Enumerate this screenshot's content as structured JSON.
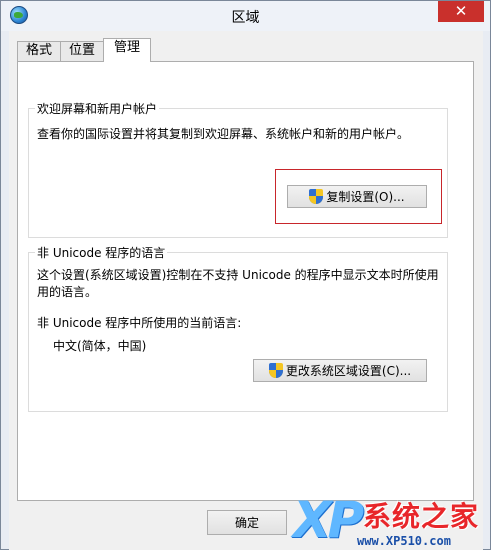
{
  "window": {
    "title": "区域",
    "close_glyph": "✕"
  },
  "tabs": [
    {
      "label": "格式",
      "active": false
    },
    {
      "label": "位置",
      "active": false
    },
    {
      "label": "管理",
      "active": true
    }
  ],
  "welcome_group": {
    "label": "欢迎屏幕和新用户帐户",
    "description": "查看你的国际设置并将其复制到欢迎屏幕、系统帐户和新的用户帐户。",
    "copy_button": "复制设置(O)...",
    "highlight_color": "#c8262b"
  },
  "non_unicode_group": {
    "label": "非 Unicode 程序的语言",
    "description_line1": "这个设置(系统区域设置)控制在不支持 Unicode 的程序中显示文本时所使用",
    "description_line2": "用的语言。",
    "current_label": "非 Unicode 程序中所使用的当前语言:",
    "current_value": "中文(简体，中国)",
    "change_button": "更改系统区域设置(C)..."
  },
  "footer": {
    "ok_button": "确定"
  },
  "watermark": {
    "brand": "XP",
    "name": "系统之家",
    "url": "www.XP510.com"
  },
  "icons": {
    "title": "globe-icon",
    "uac": "uac-shield-icon"
  }
}
